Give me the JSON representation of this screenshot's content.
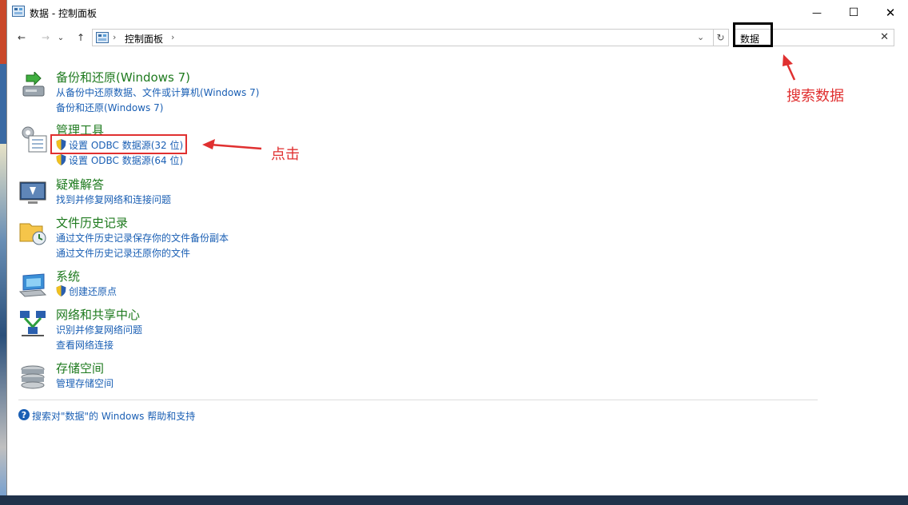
{
  "window": {
    "title": "数据 - 控制面板",
    "minimize": "—",
    "maximize": "☐",
    "close": "✕"
  },
  "address": {
    "back": "←",
    "forward": "→",
    "recent": "⌄",
    "up": "↑",
    "sep1": "›",
    "crumb": "控制面板",
    "sep2": "›",
    "dropdown": "⌄",
    "refresh": "↻"
  },
  "search": {
    "value": "数据",
    "clear": "✕"
  },
  "categories": [
    {
      "title": "备份和还原(Windows 7)",
      "links": [
        "从备份中还原数据、文件或计算机(Windows 7)",
        "备份和还原(Windows 7)"
      ]
    },
    {
      "title": "管理工具",
      "links": [
        "设置 ODBC 数据源(32 位)",
        "设置 ODBC 数据源(64 位)"
      ]
    },
    {
      "title": "疑难解答",
      "links": [
        "找到并修复网络和连接问题"
      ]
    },
    {
      "title": "文件历史记录",
      "links": [
        "通过文件历史记录保存你的文件备份副本",
        "通过文件历史记录还原你的文件"
      ]
    },
    {
      "title": "系统",
      "links": [
        "创建还原点"
      ]
    },
    {
      "title": "网络和共享中心",
      "links": [
        "识别并修复网络问题",
        "查看网络连接"
      ]
    },
    {
      "title": "存储空间",
      "links": [
        "管理存储空间"
      ]
    }
  ],
  "help": {
    "icon": "?",
    "text": "搜索对\"数据\"的 Windows 帮助和支持"
  },
  "annotations": {
    "search_label": "搜索数据",
    "click_label": "点击",
    "color": "#e03030"
  }
}
